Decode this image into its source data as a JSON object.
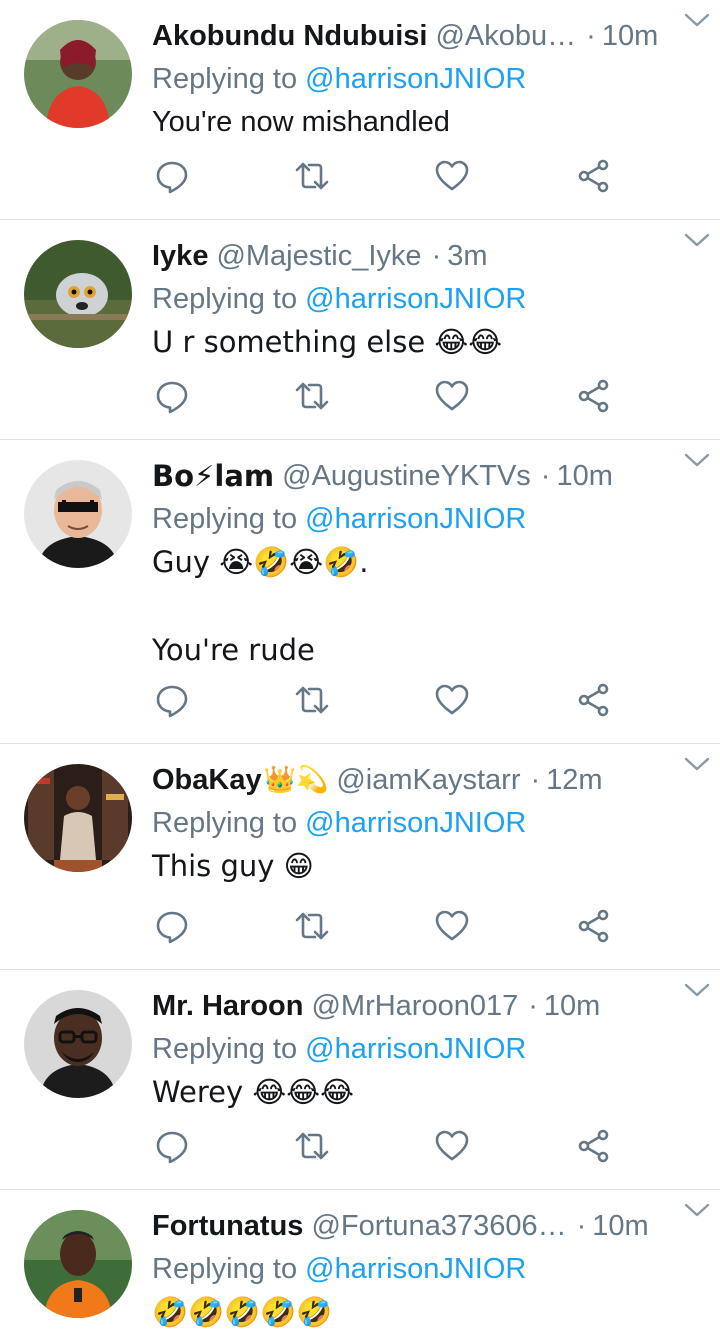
{
  "reply_prefix": "Replying to",
  "reply_handle": "@harrisonJNIOR",
  "tweets": [
    {
      "name": "Akobundu Ndubuisi",
      "handle": "@Akobu…",
      "time": "10m",
      "text": "You're now mishandled"
    },
    {
      "name": "Iyke",
      "handle": "@Majestic_Iyke",
      "time": "3m",
      "text": "U r something else 😂😂"
    },
    {
      "name": "Bo⚡lam",
      "handle": "@AugustineYKTVs",
      "time": "10m",
      "text": "Guy 😭🤣😭🤣.\n\nYou're rude"
    },
    {
      "name": "ObaKay",
      "name_emoji": "👑💫",
      "handle": "@iamKaystarr",
      "time": "12m",
      "text": "This guy 😁"
    },
    {
      "name": "Mr. Haroon",
      "handle": "@MrHaroon017",
      "time": "10m",
      "text": "Werey 😂😂😂"
    },
    {
      "name": "Fortunatus",
      "handle": "@Fortuna373606…",
      "time": "10m",
      "text": "🤣🤣🤣🤣🤣"
    }
  ],
  "colors": {
    "link": "#1da1f2",
    "muted": "#657786",
    "divider": "#dfe3e6"
  },
  "icons": [
    "reply-icon",
    "retweet-icon",
    "like-icon",
    "share-icon",
    "chevron-down-icon"
  ]
}
